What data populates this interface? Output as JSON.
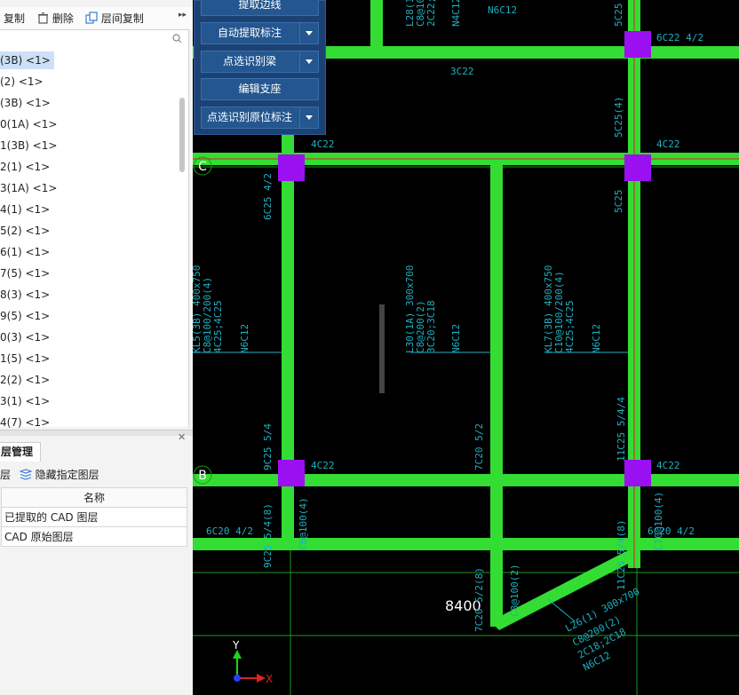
{
  "toolbar": {
    "copy_label": "复制",
    "delete_label": "删除",
    "floor_copy_label": "层间复制",
    "more_glyph": "▸▸"
  },
  "beam_list": [
    "(3B) <1>",
    "(2) <1>",
    "(3B) <1>",
    "0(1A) <1>",
    "1(3B) <1>",
    "2(1) <1>",
    "3(1A) <1>",
    "4(1) <1>",
    "5(2) <1>",
    "6(1) <1>",
    "7(5) <1>",
    "8(3) <1>",
    "9(5) <1>",
    "0(3) <1>",
    "1(5) <1>",
    "2(2) <1>",
    "3(1) <1>",
    "4(7) <1>"
  ],
  "layer_panel": {
    "title": "层管理",
    "layer_btn": "层",
    "hide_layers_label": "隐藏指定图层",
    "table_header": "名称",
    "rows": [
      "已提取的 CAD 图层",
      "CAD 原始图层"
    ]
  },
  "floating_menu": {
    "items": [
      "提取边线",
      "自动提取标注",
      "点选识别梁",
      "编辑支座",
      "点选识别原位标注"
    ]
  },
  "cad": {
    "axis_labels": [
      "C",
      "B"
    ],
    "dimension": "8400",
    "ucs_x": "X",
    "ucs_y": "Y",
    "annotations": [
      "N6C12",
      "5C25",
      "6C22 4/2",
      "3C22",
      "4C22",
      "4C22",
      "6C25 4/2",
      "5C25",
      "5C25(4)",
      "KL5(3B) 400x750",
      "C8@100/200(4)",
      "4C25;4C25",
      "N6C12",
      "L30(1A) 300x700",
      "C8@200(2)",
      "3C20;3C18",
      "N6C12",
      "KL7(3B) 400x750",
      "C10@100/200(4)",
      "4C25;4C25",
      "N6C12",
      "9C25 5/4",
      "7C20 5/2",
      "11C25 5/4/4",
      "4C22",
      "4C22",
      "6C20 4/2",
      "6C20 4/2",
      "L26(1) 300x700",
      "C8@200(2)",
      "2C18;2C18",
      "N6C12",
      "L28(1)",
      "C8@10",
      "2C22;",
      "N4C12",
      "C8@100(4)",
      "C8@100(2)",
      "7C20 5/2(8)",
      "9C25 5/4(8)",
      "11C25 5/4(8)",
      "C10@100(4)"
    ]
  },
  "colors": {
    "beam": "#33dd33",
    "column": "#9a10f0",
    "text": "#1fb0c0",
    "axis": "#1a9a1a",
    "menu_bg": "#1c4274",
    "menu_btn": "#24568f",
    "selection": "#cce0f7"
  }
}
